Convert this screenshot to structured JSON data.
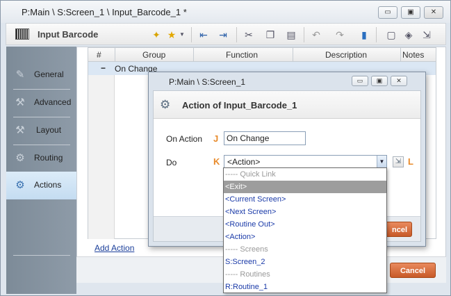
{
  "window": {
    "title": "P:Main \\ S:Screen_1 \\ Input_Barcode_1 *",
    "minimize": "▭",
    "maximize": "▣",
    "close": "✕"
  },
  "toolbar": {
    "title": "Input Barcode"
  },
  "sidebar": {
    "items": [
      {
        "label": "General",
        "icon": "general-icon"
      },
      {
        "label": "Advanced",
        "icon": "advanced-icon"
      },
      {
        "label": "Layout",
        "icon": "layout-icon"
      },
      {
        "label": "Routing",
        "icon": "routing-icon"
      },
      {
        "label": "Actions",
        "icon": "actions-icon",
        "active": true
      }
    ]
  },
  "grid": {
    "headers": [
      "#",
      "Group",
      "Function",
      "Description",
      "Notes"
    ],
    "row": {
      "toggle": "−",
      "group": "On Change"
    }
  },
  "add_action": "Add Action",
  "footer": {
    "cancel": "Cancel"
  },
  "dialog": {
    "title": "P:Main \\ S:Screen_1",
    "header": "Action of Input_Barcode_1",
    "on_action_label": "On Action",
    "on_action_marker": "J",
    "on_action_value": "On Change",
    "do_label": "Do",
    "do_marker": "K",
    "do_value": "<Action>",
    "edit_marker": "L",
    "cancel_partial": "ncel"
  },
  "dropdown": {
    "items": [
      {
        "text": "----- Quick Link",
        "kind": "group"
      },
      {
        "text": "<Exit>",
        "kind": "sel"
      },
      {
        "text": "<Current Screen>",
        "kind": "item"
      },
      {
        "text": "<Next Screen>",
        "kind": "item"
      },
      {
        "text": "<Routine Out>",
        "kind": "item"
      },
      {
        "text": "<Action>",
        "kind": "item"
      },
      {
        "text": "----- Screens",
        "kind": "group"
      },
      {
        "text": "S:Screen_2",
        "kind": "item"
      },
      {
        "text": "----- Routines",
        "kind": "group"
      },
      {
        "text": "R:Routine_1",
        "kind": "item"
      }
    ]
  },
  "colors": {
    "accent_orange": "#e88a2a",
    "sidebar": "#8e9ba8",
    "active_tab": "#c4dcf1",
    "link": "#1a3e9a"
  }
}
